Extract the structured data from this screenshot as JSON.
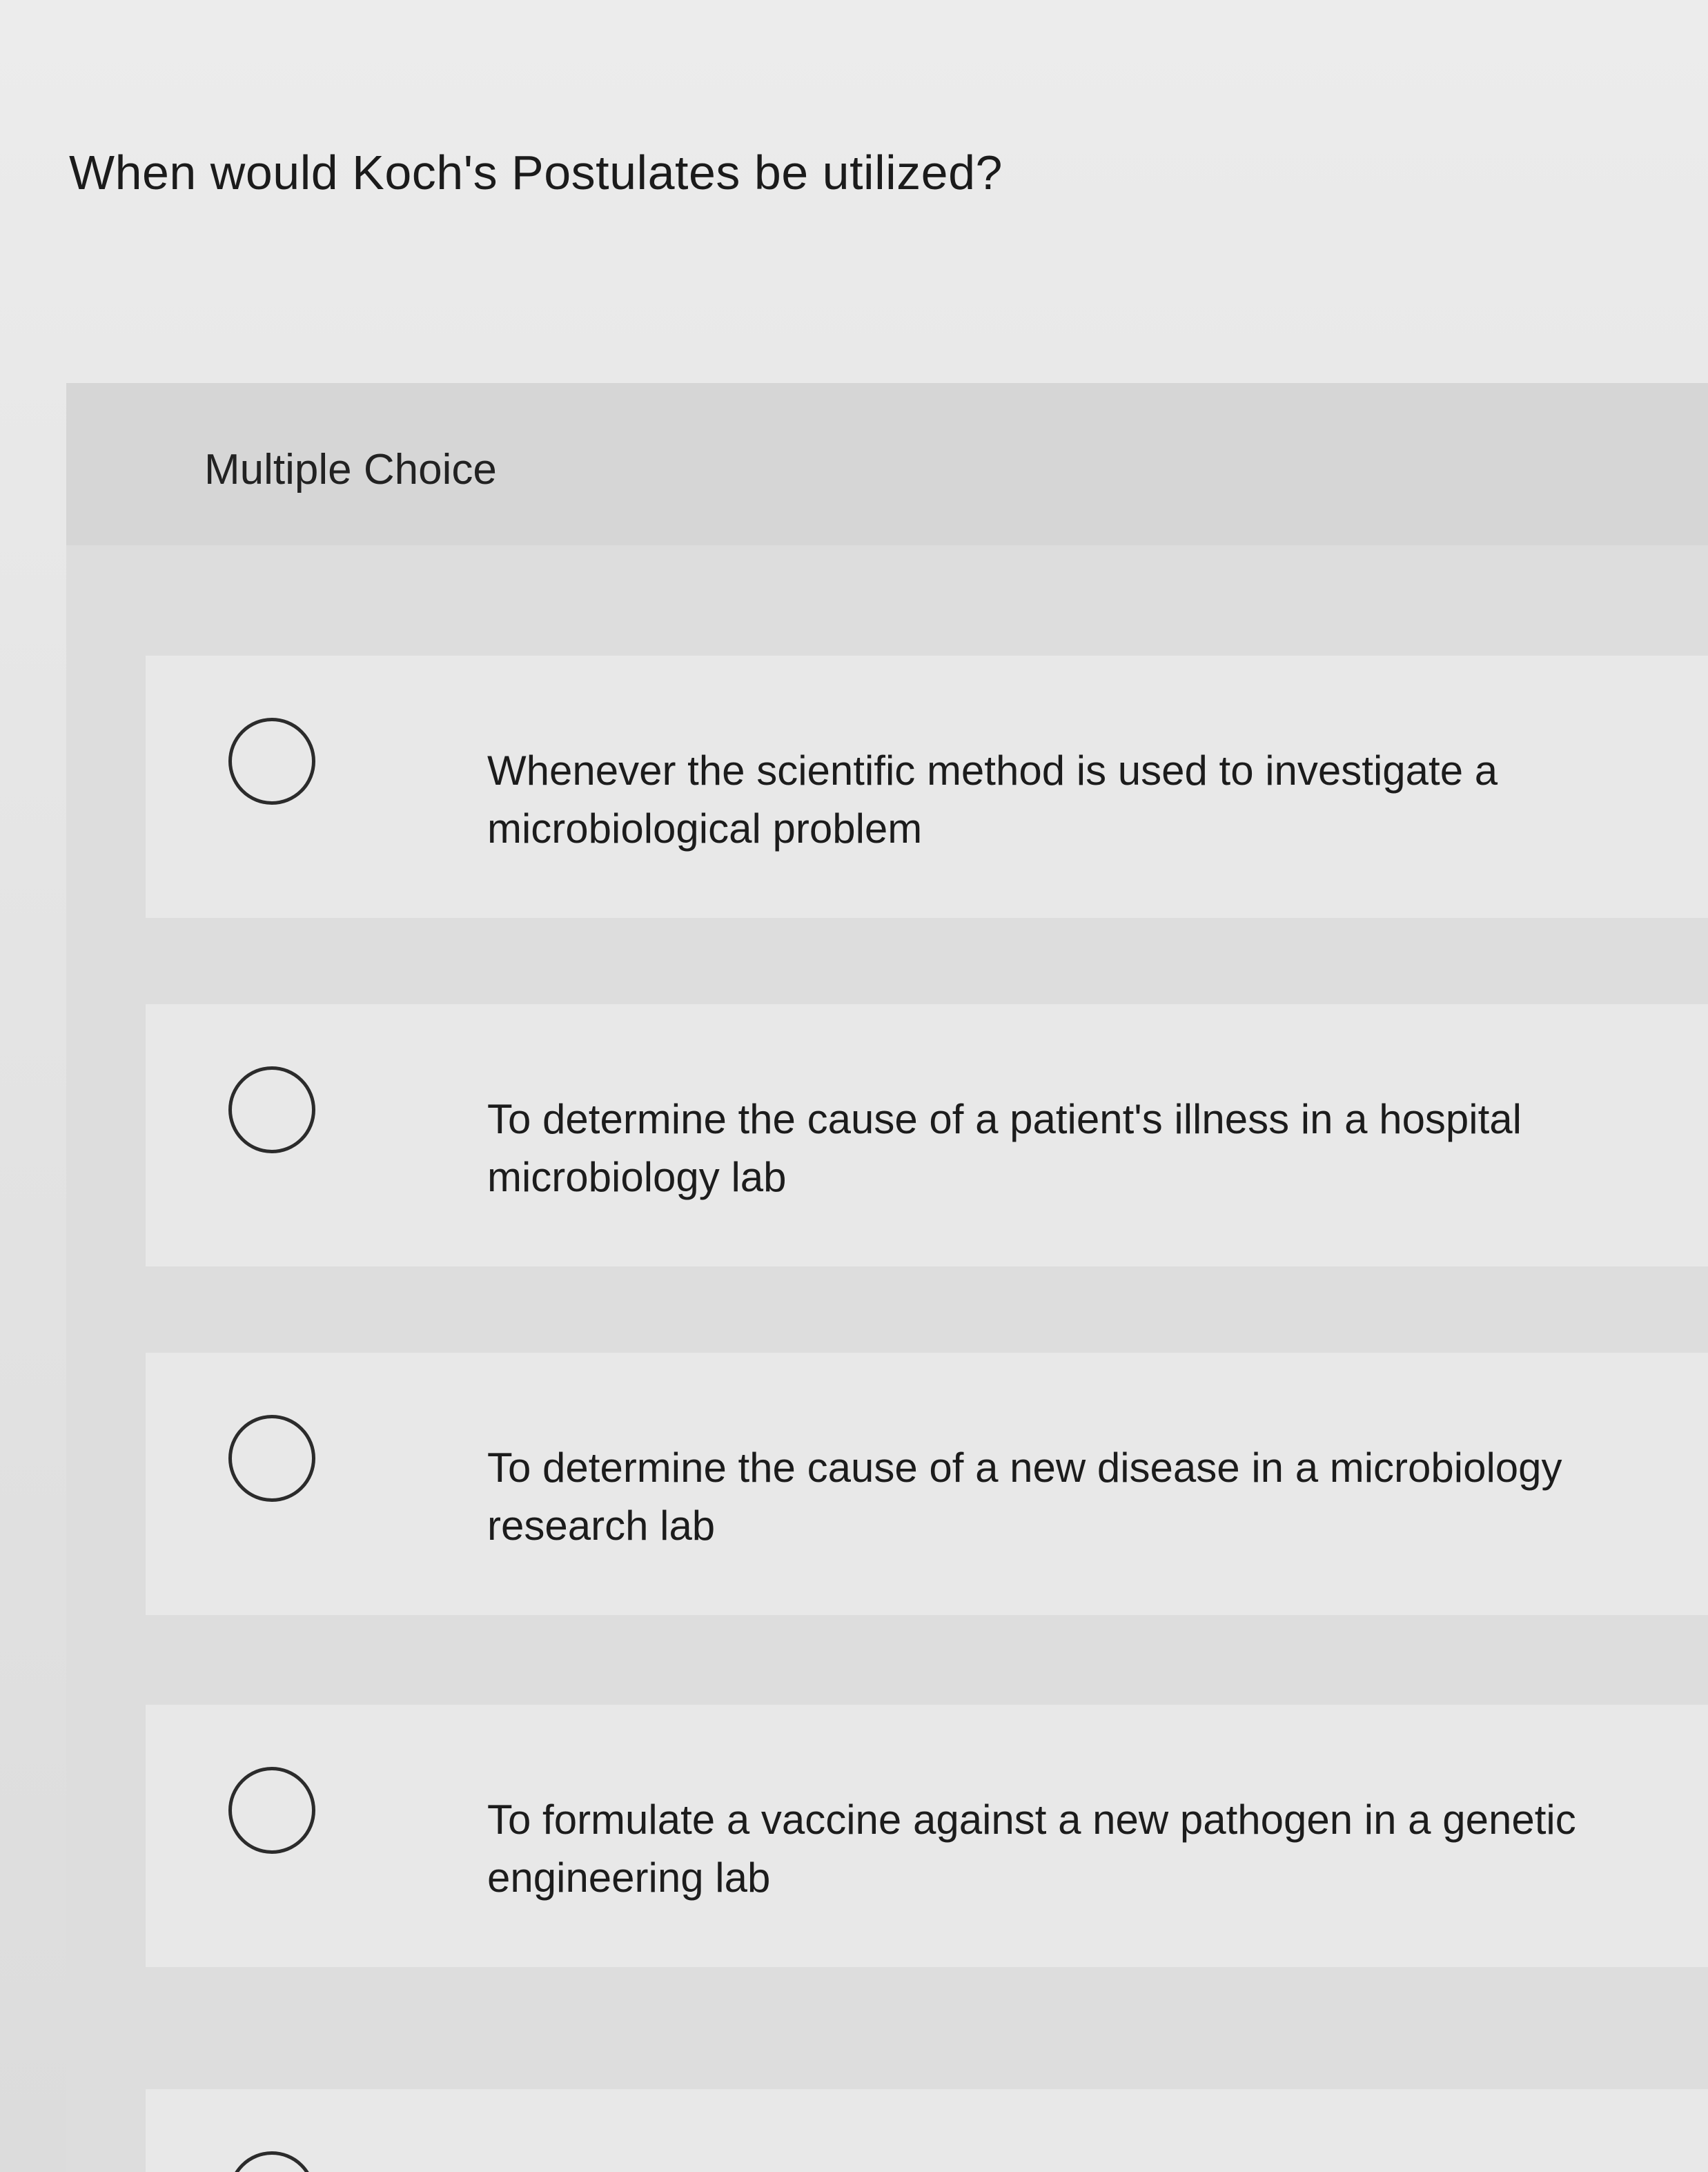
{
  "question": {
    "text": "When would Koch's Postulates be utilized?"
  },
  "answer_panel": {
    "type_label": "Multiple Choice",
    "options": [
      {
        "label": "Whenever the scientific method is used to investigate a microbiological problem",
        "selected": false
      },
      {
        "label": "To determine the cause of a patient's illness in a hospital microbiology lab",
        "selected": false
      },
      {
        "label": "To determine the cause of a new disease in a microbiology research lab",
        "selected": false
      },
      {
        "label": "To formulate a vaccine against a new pathogen in a genetic engineering lab",
        "selected": false
      }
    ]
  },
  "colors": {
    "background": "#e6e6e6",
    "panel": "#dddddd",
    "option_row": "#e8e8e8",
    "text": "#1a1a1a"
  }
}
